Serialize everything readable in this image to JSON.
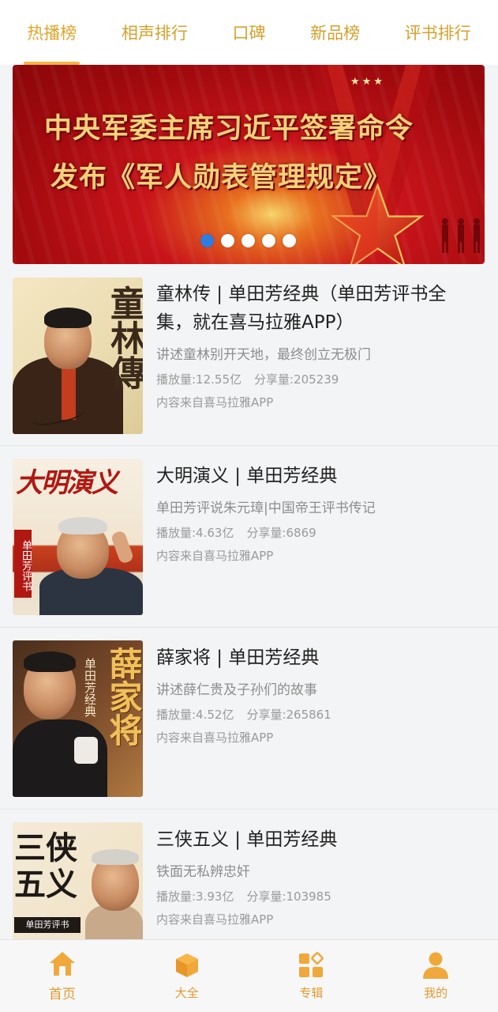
{
  "tabs": [
    {
      "label": "热播榜",
      "active": true
    },
    {
      "label": "相声排行",
      "active": false
    },
    {
      "label": "口碑",
      "active": false
    },
    {
      "label": "新品榜",
      "active": false
    },
    {
      "label": "评书排行",
      "active": false
    }
  ],
  "banner": {
    "line1": "中央军委主席习近平签署命令",
    "line2": "发布《军人勋表管理规定》",
    "stars": "★★★",
    "slide_count": 5,
    "active_slide": 1
  },
  "items": [
    {
      "title": "童林传 | 单田芳经典（单田芳评书全集，就在喜马拉雅APP）",
      "desc": "讲述童林别开天地，最终创立无极门",
      "plays": "播放量:12.55亿",
      "shares": "分享量:205239",
      "source": "内容来自喜马拉雅APP",
      "cover_text": "童林傳"
    },
    {
      "title": "大明演义 | 单田芳经典",
      "desc": "单田芳评说朱元璋|中国帝王评书传记",
      "plays": "播放量:4.63亿",
      "shares": "分享量:6869",
      "source": "内容来自喜马拉雅APP",
      "cover_text": "大明演义",
      "cover_tag": "单田芳评书"
    },
    {
      "title": "薛家将 | 单田芳经典",
      "desc": "讲述薛仁贵及子孙们的故事",
      "plays": "播放量:4.52亿",
      "shares": "分享量:265861",
      "source": "内容来自喜马拉雅APP",
      "cover_text": "薛家将",
      "cover_tag": "单田芳经典"
    },
    {
      "title": "三侠五义 | 单田芳经典",
      "desc": "铁面无私辨忠奸",
      "plays": "播放量:3.93亿",
      "shares": "分享量:103985",
      "source": "内容来自喜马拉雅APP",
      "cover_text": "三侠五义",
      "cover_tag": "单田芳评书"
    }
  ],
  "nav": [
    {
      "label": "首页",
      "icon": "home-icon",
      "active": true
    },
    {
      "label": "大全",
      "icon": "cube-icon",
      "active": false
    },
    {
      "label": "专辑",
      "icon": "apps-icon",
      "active": false
    },
    {
      "label": "我的",
      "icon": "user-icon",
      "active": false
    }
  ],
  "colors": {
    "accent": "#e0a52c",
    "active_dot": "#2d7de0",
    "banner_red": "#c8141a"
  }
}
